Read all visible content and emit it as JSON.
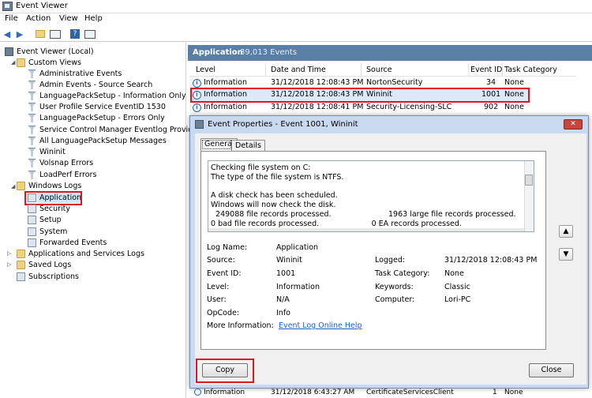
{
  "window": {
    "title": "Event Viewer"
  },
  "menu": [
    "File",
    "Action",
    "View",
    "Help"
  ],
  "tree": {
    "root": "Event Viewer (Local)",
    "custom_views": "Custom Views",
    "custom_items": [
      "Administrative Events",
      "Admin Events - Source Search",
      "LanguagePackSetup - Information Only",
      "User Profile Service EventID 1530",
      "LanguagePackSetup - Errors Only",
      "Service Control Manager Eventlog Provider",
      "All LanguagePackSetup Messages",
      "Wininit",
      "Volsnap Errors",
      "LoadPerf Errors"
    ],
    "windows_logs": "Windows Logs",
    "log_items": [
      "Application",
      "Security",
      "Setup",
      "System",
      "Forwarded Events"
    ],
    "apps_services": "Applications and Services Logs",
    "saved_logs": "Saved Logs",
    "subscriptions": "Subscriptions"
  },
  "right_header": {
    "title": "Application",
    "count": "39,013 Events"
  },
  "columns": [
    "Level",
    "Date and Time",
    "Source",
    "Event ID",
    "Task Category"
  ],
  "rows": [
    {
      "level": "Information",
      "datetime": "31/12/2018 12:08:43 PM",
      "source": "NortonSecurity",
      "event_id": "34",
      "task": "None"
    },
    {
      "level": "Information",
      "datetime": "31/12/2018 12:08:43 PM",
      "source": "Wininit",
      "event_id": "1001",
      "task": "None"
    },
    {
      "level": "Information",
      "datetime": "31/12/2018 12:08:41 PM",
      "source": "Security-Licensing-SLC",
      "event_id": "902",
      "task": "None"
    }
  ],
  "dialog": {
    "title": "Event Properties - Event 1001, Wininit",
    "tabs": [
      "General",
      "Details"
    ],
    "text_lines": [
      "Checking file system on C:",
      "The type of the file system is NTFS.",
      "",
      "A disk check has been scheduled.",
      "Windows will now check the disk.",
      "  249088 file records processed.                        1963 large file records processed.",
      "0 bad file records processed.                      0 EA records processed."
    ],
    "fields": {
      "log_name_label": "Log Name:",
      "log_name": "Application",
      "source_label": "Source:",
      "source": "Wininit",
      "logged_label": "Logged:",
      "logged": "31/12/2018 12:08:43 PM",
      "event_id_label": "Event ID:",
      "event_id": "1001",
      "task_label": "Task Category:",
      "task": "None",
      "level_label": "Level:",
      "level": "Information",
      "keywords_label": "Keywords:",
      "keywords": "Classic",
      "user_label": "User:",
      "user": "N/A",
      "computer_label": "Computer:",
      "computer": "Lori-PC",
      "opcode_label": "OpCode:",
      "opcode": "Info",
      "more_info_label": "More Information:",
      "more_info_link": "Event Log Online Help"
    },
    "copy_label": "Copy",
    "close_label": "Close"
  },
  "bottom_row": {
    "level": "Information",
    "datetime": "31/12/2018 6:43:27 AM",
    "source": "CertificateServicesClient",
    "event_id": "1",
    "task": "None"
  },
  "colors": {
    "accent_header": "#5a7fa6",
    "selection": "#cce8ff",
    "highlight_box": "#e0161e",
    "link": "#1b5fcf"
  }
}
